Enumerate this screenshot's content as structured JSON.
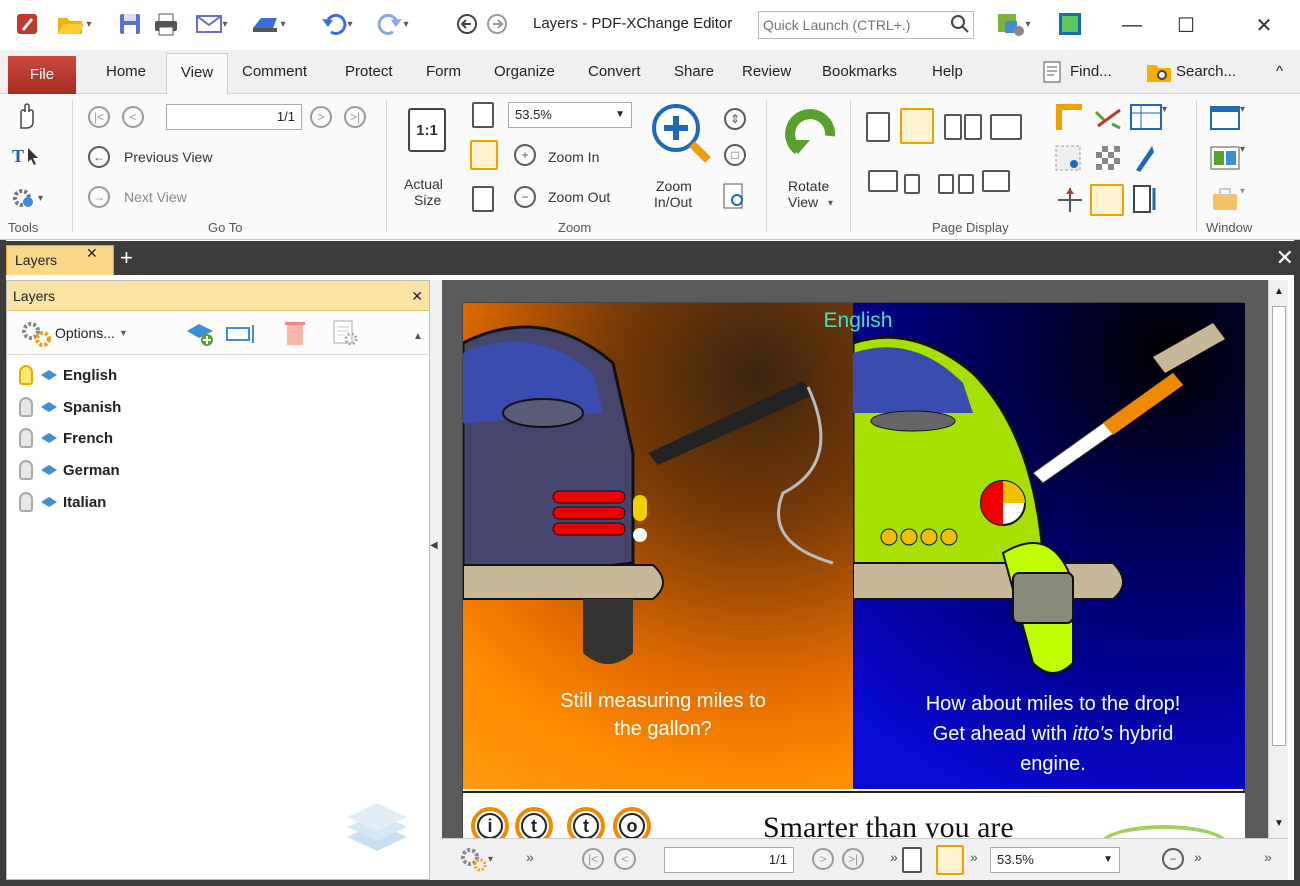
{
  "window": {
    "title": "Layers - PDF-XChange Editor",
    "quick_launch_placeholder": "Quick Launch (CTRL+.)"
  },
  "ribbon_tabs": [
    "File",
    "Home",
    "View",
    "Comment",
    "Protect",
    "Form",
    "Organize",
    "Convert",
    "Share",
    "Review",
    "Bookmarks",
    "Help"
  ],
  "ribbon_right": {
    "find_label": "Find...",
    "search_label": "Search..."
  },
  "ribbon": {
    "tools_label": "Tools",
    "goto_label": "Go To",
    "page_field": "1/1",
    "previous_view": "Previous View",
    "next_view": "Next View",
    "actual_size_line1": "Actual",
    "actual_size_line2": "Size",
    "actual_size_glyph": "1:1",
    "zoom_value": "53.5%",
    "zoom_in": "Zoom In",
    "zoom_out": "Zoom Out",
    "zoom_inout_line1": "Zoom",
    "zoom_inout_line2": "In/Out",
    "zoom_label": "Zoom",
    "rotate_line1": "Rotate",
    "rotate_line2": "View",
    "page_display_label": "Page Display",
    "window_label": "Window"
  },
  "doc_tab": {
    "label": "Layers"
  },
  "layers_pane": {
    "title": "Layers",
    "options_label": "Options...",
    "layers": [
      {
        "name": "English",
        "visible": true
      },
      {
        "name": "Spanish",
        "visible": false
      },
      {
        "name": "French",
        "visible": false
      },
      {
        "name": "German",
        "visible": false
      },
      {
        "name": "Italian",
        "visible": false
      }
    ]
  },
  "document": {
    "heading": "English",
    "caption_left_1": "Still measuring miles to",
    "caption_left_2": "the gallon?",
    "caption_right_1": "How about miles to the drop!",
    "caption_right_2a": "Get ahead with ",
    "caption_right_2b": "itto's",
    "caption_right_2c": " hybrid",
    "caption_right_3": "engine.",
    "brand_letters": [
      "i",
      "t",
      "t",
      "o"
    ],
    "slogan": "Smarter than you are"
  },
  "status_bar": {
    "page_field": "1/1",
    "zoom_value": "53.5%"
  },
  "colors": {
    "file_tab": "#c0392b",
    "layers_tab": "#f9d889",
    "accent": "#f0a000"
  }
}
